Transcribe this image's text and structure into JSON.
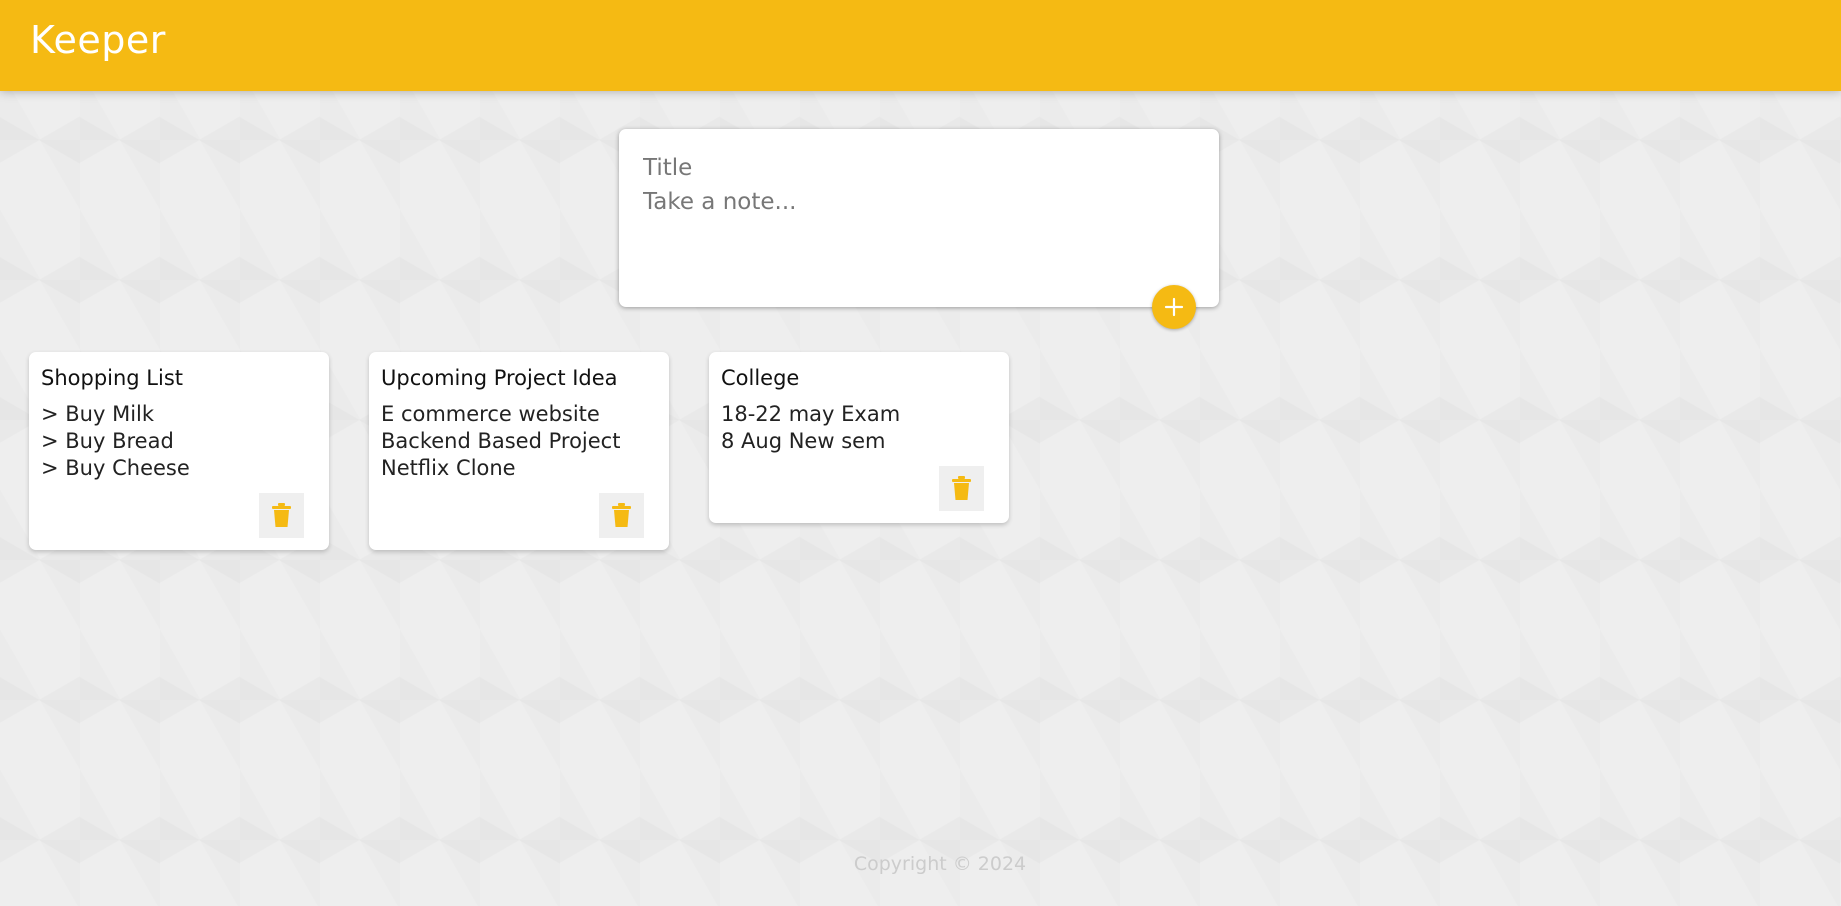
{
  "header": {
    "title": "Keeper"
  },
  "create_note": {
    "title_placeholder": "Title",
    "content_placeholder": "Take a note...",
    "add_icon": "plus-icon"
  },
  "notes": [
    {
      "title": "Shopping List",
      "lines": [
        "> Buy Milk",
        "> Buy Bread",
        "> Buy Cheese"
      ],
      "delete_icon": "trash-icon"
    },
    {
      "title": "Upcoming Project Idea",
      "lines": [
        "E commerce website",
        "Backend Based Project",
        "Netflix Clone"
      ],
      "delete_icon": "trash-icon"
    },
    {
      "title": "College",
      "lines": [
        "18-22 may Exam",
        "8 Aug New sem"
      ],
      "delete_icon": "trash-icon"
    }
  ],
  "footer": {
    "text": "Copyright © 2024"
  },
  "colors": {
    "accent": "#f5ba13",
    "background": "#eeeeee",
    "card": "#ffffff"
  }
}
